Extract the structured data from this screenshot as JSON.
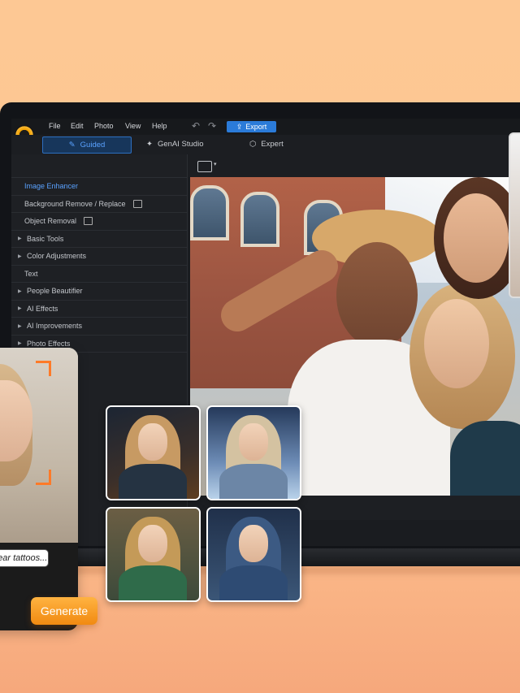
{
  "menu": {
    "items": [
      "File",
      "Edit",
      "Photo",
      "View",
      "Help"
    ],
    "export_label": "Export"
  },
  "modes": {
    "guided": "Guided",
    "genai": "GenAI Studio",
    "expert": "Expert"
  },
  "panel": {
    "items": [
      {
        "label": "Image Enhancer",
        "arrow": false,
        "highlight": true
      },
      {
        "label": "Background Remove / Replace",
        "arrow": false
      },
      {
        "label": "Object Removal",
        "arrow": false
      },
      {
        "label": "Basic Tools",
        "arrow": true
      },
      {
        "label": "Color Adjustments",
        "arrow": true
      },
      {
        "label": "Text",
        "arrow": false
      },
      {
        "label": "People Beautifier",
        "arrow": true
      },
      {
        "label": "AI Effects",
        "arrow": true
      },
      {
        "label": "AI Improvements",
        "arrow": true
      },
      {
        "label": "Photo Effects",
        "arrow": true
      }
    ]
  },
  "phone": {
    "prompt_text": "gear tattoos...",
    "generate_label": "Generate"
  },
  "colors": {
    "background": "#fdc894",
    "accent_blue": "#2b7bd9",
    "generate_orange": "#f7a12a",
    "bracket_orange": "#ff7a28"
  }
}
